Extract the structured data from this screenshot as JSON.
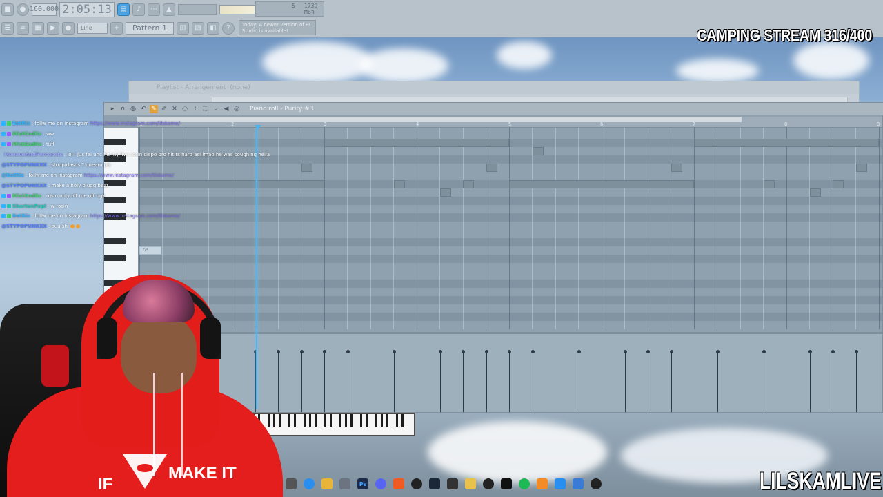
{
  "toolbar": {
    "tempo": "160.000",
    "time": "2:05:13",
    "mem_top": "5",
    "mem_mb": "1739 MB",
    "mem_bottom": "3",
    "snap_mode": "Line",
    "pattern": "Pattern 1",
    "notice": "Today: A newer version of FL Studio is available!"
  },
  "overlay": {
    "camping": "CAMPING STREAM 316/400",
    "brand": "LILSKAMLIVE"
  },
  "playlist": {
    "title": "Playlist - Arrangement",
    "pattern": "(none)"
  },
  "piano_roll": {
    "title": "Piano roll - Purity #3",
    "bars": [
      "1",
      "2",
      "3",
      "4",
      "5",
      "6",
      "7",
      "8",
      "9"
    ],
    "note_label": "D5"
  },
  "chat": [
    {
      "user": "BotRix",
      "color": "#2fb4ff",
      "text": ": follw me on instagram",
      "link": "https://www.instagram.com/lilskame/"
    },
    {
      "user": "MistGodRx",
      "color": "#3fd06a",
      "text": ": ww",
      "link": ""
    },
    {
      "user": "MistGodRx",
      "color": "#3fd06a",
      "text": ": tuff",
      "link": ""
    },
    {
      "user": "MoeaveAndPercocets",
      "color": "#9aa4ff",
      "text": ": lol I jus fel unc hit my live rosin dispo bro hit ts hard asl lmao he was coughing hella",
      "link": ""
    },
    {
      "user": "@STYPOPUNKXX",
      "color": "#4f7dff",
      "text": ": stoopidasos ? oneam pls",
      "link": ""
    },
    {
      "user": "@BotRix",
      "color": "#2fb4ff",
      "text": ": follw me on instagram",
      "link": "https://www.instagram.com/lilskame/"
    },
    {
      "user": "@STYPOPUNKXX",
      "color": "#4f7dff",
      "text": ": make a holy plugg beat",
      "link": ""
    },
    {
      "user": "MistGodRx",
      "color": "#3fd06a",
      "text": ": rosin only hit me off rigz",
      "link": ""
    },
    {
      "user": "ShortenPopl",
      "color": "#28c6b4",
      "text": ": w rosin",
      "link": ""
    },
    {
      "user": "BotRix",
      "color": "#2fb4ff",
      "text": ": follw me on instagram",
      "link": "https://www.instagram.com/lilskame/"
    },
    {
      "user": "@STYPOPUNKXX",
      "color": "#4f7dff",
      "text": ": ouu shi",
      "link": ""
    }
  ],
  "hoodie": {
    "left": "IF",
    "right": "MAKE IT"
  },
  "taskbar": [
    "explorer",
    "chrome",
    "folder",
    "files",
    "photoshop",
    "discord",
    "brave",
    "obs",
    "steam",
    "music",
    "layers",
    "ak",
    "capcut",
    "spotify",
    "fl-studio",
    "photos",
    "notepad",
    "media-player"
  ]
}
